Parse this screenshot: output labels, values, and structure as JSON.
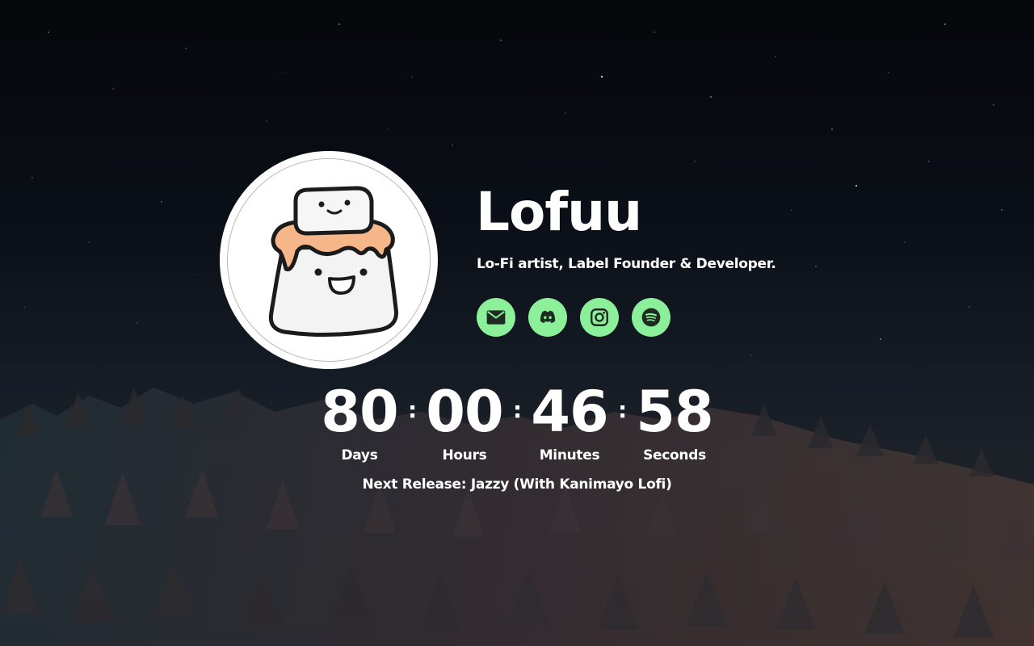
{
  "profile": {
    "name": "Lofuu",
    "bio": "Lo-Fi artist, Label Founder & Developer.",
    "avatar_icon": "pudding-mascot-icon"
  },
  "social": {
    "accent_color": "#8cf09a",
    "icon_color": "#1f2a22",
    "links": [
      {
        "icon": "email-icon"
      },
      {
        "icon": "discord-icon"
      },
      {
        "icon": "instagram-icon"
      },
      {
        "icon": "spotify-icon"
      }
    ]
  },
  "countdown": {
    "days": "80",
    "hours": "00",
    "minutes": "46",
    "seconds": "58",
    "days_label": "Days",
    "hours_label": "Hours",
    "minutes_label": "Minutes",
    "seconds_label": "Seconds",
    "separator": ":"
  },
  "release": {
    "text": "Next Release: Jazzy (With Kanimayo Lofi)"
  }
}
